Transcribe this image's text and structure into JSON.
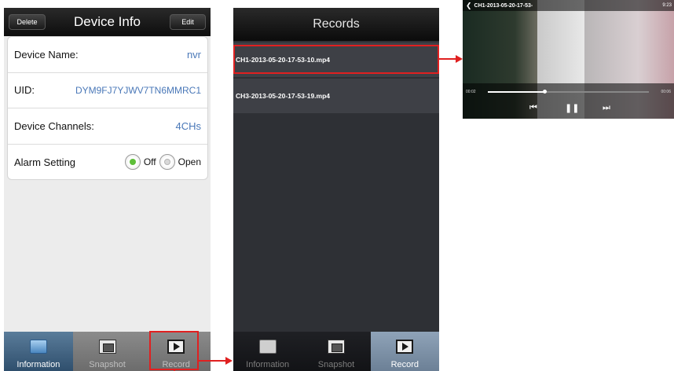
{
  "device_info": {
    "title": "Device Info",
    "delete_label": "Delete",
    "edit_label": "Edit",
    "rows": {
      "name": {
        "label": "Device Name:",
        "value": "nvr"
      },
      "uid": {
        "label": "UID:",
        "value": "DYM9FJ7YJWV7TN6MMRC1"
      },
      "channels": {
        "label": "Device Channels:",
        "value": "4CHs"
      },
      "alarm": {
        "label": "Alarm Setting",
        "off_label": "Off",
        "open_label": "Open",
        "selected": "Off"
      }
    },
    "tabs": [
      {
        "label": "Information",
        "icon": "information-icon",
        "active": true
      },
      {
        "label": "Snapshot",
        "icon": "snapshot-icon",
        "active": false
      },
      {
        "label": "Record",
        "icon": "record-icon",
        "active": false
      }
    ]
  },
  "records": {
    "title": "Records",
    "items": [
      "CH1-2013-05-20-17-53-10.mp4",
      "CH3-2013-05-20-17-53-19.mp4"
    ],
    "tabs": [
      {
        "label": "Information",
        "icon": "information-icon",
        "active": false
      },
      {
        "label": "Snapshot",
        "icon": "snapshot-icon",
        "active": false
      },
      {
        "label": "Record",
        "icon": "record-icon",
        "active": true
      }
    ]
  },
  "player": {
    "title": "CH1-2013-05-20-17-53-",
    "status_time": "9:23",
    "current_time": "00:02",
    "end_time": "00:06",
    "progress": 0.35
  },
  "colors": {
    "highlight": "#e02020",
    "value_blue": "#4a78b8",
    "radio_on": "#5fbf3a"
  }
}
